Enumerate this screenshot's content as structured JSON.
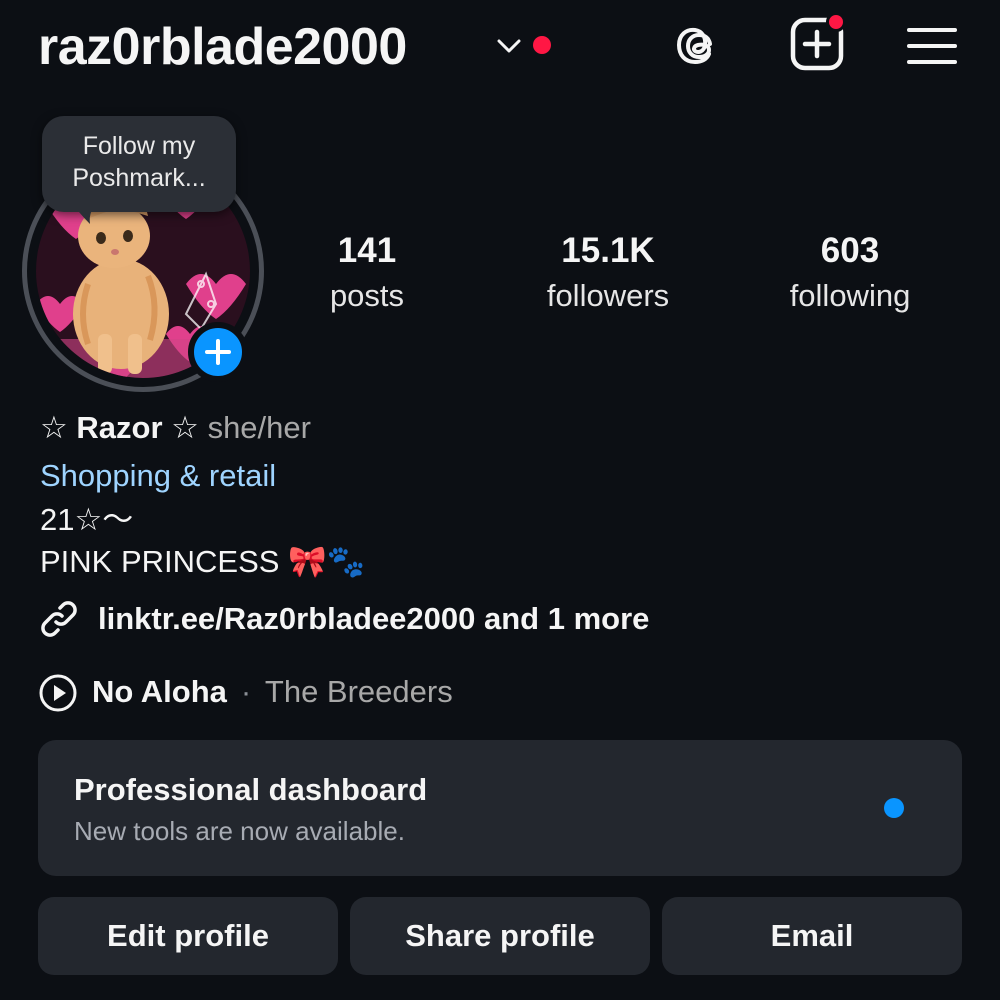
{
  "header": {
    "username": "raz0rblade2000",
    "icons": [
      "chevron-down-icon",
      "threads-icon",
      "create-post-icon",
      "menu-icon"
    ],
    "notification_color": "#ff1744"
  },
  "profile": {
    "note": "Follow my Poshmark...",
    "avatar_description": "orange tabby cat on pink background",
    "stats": [
      {
        "value": "141",
        "label": "posts"
      },
      {
        "value": "15.1K",
        "label": "followers"
      },
      {
        "value": "603",
        "label": "following"
      }
    ],
    "name": "☆ Razor ☆",
    "pronouns": "she/her",
    "category": "Shopping & retail",
    "bio_line1": "21☆〜",
    "bio_line2": "PINK PRINCESS 🎀🐾",
    "link": "linktr.ee/Raz0rbladee2000 and 1 more",
    "music": {
      "title": "No Aloha",
      "separator": "·",
      "artist": "The Breeders"
    }
  },
  "dashboard": {
    "title": "Professional dashboard",
    "subtitle": "New tools are now available.",
    "dot_color": "#0a95ff"
  },
  "actions": {
    "edit": "Edit profile",
    "share": "Share profile",
    "email": "Email"
  },
  "colors": {
    "background": "#0c0f14",
    "surface": "#23272e",
    "accent": "#0a95ff",
    "category": "#9fd4ff"
  }
}
